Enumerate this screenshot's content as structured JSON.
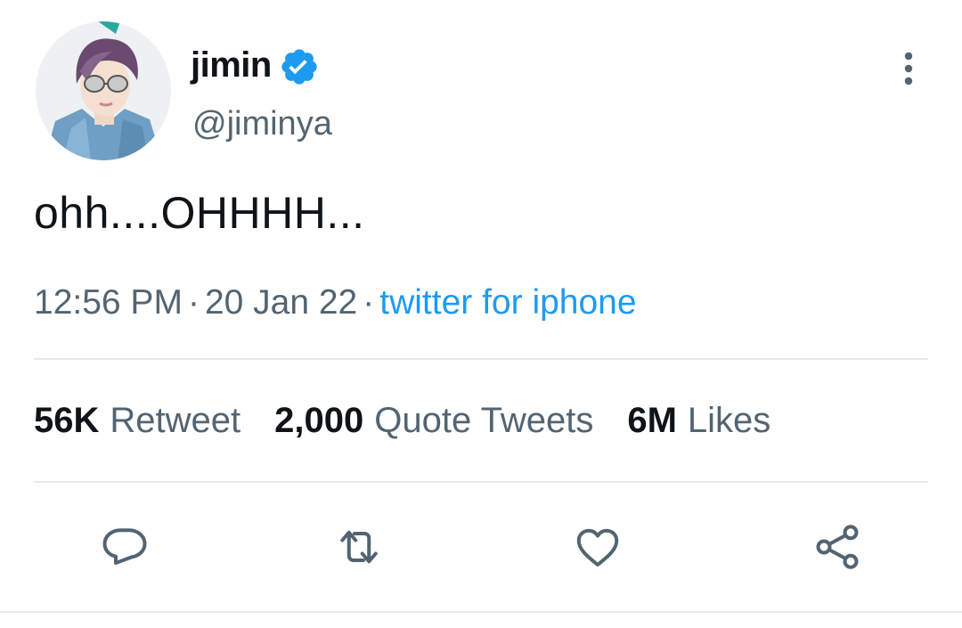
{
  "author": {
    "display_name": "jimin",
    "handle": "@jiminya",
    "verified": true
  },
  "tweet": {
    "text": "ohh....OHHHH..."
  },
  "meta": {
    "time": "12:56 PM",
    "separator": "·",
    "date": "20 Jan 22",
    "source": "twitter for iphone"
  },
  "stats": {
    "retweets": {
      "count": "56K",
      "label": "Retweet"
    },
    "quotes": {
      "count": "2,000",
      "label": "Quote Tweets"
    },
    "likes": {
      "count": "6M",
      "label": "Likes"
    }
  },
  "actions": [
    {
      "icon": "reply-icon"
    },
    {
      "icon": "retweet-icon"
    },
    {
      "icon": "like-icon"
    },
    {
      "icon": "share-icon"
    }
  ],
  "colors": {
    "link": "#1d9bf0",
    "text": "#0f1419",
    "secondary": "#536471",
    "divider": "#e7e9ec"
  }
}
